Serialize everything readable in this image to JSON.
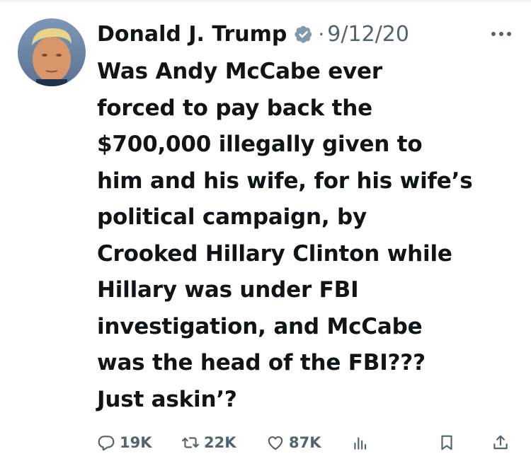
{
  "tweet": {
    "author_name": "Donald J. Trump",
    "separator": "·",
    "date": "9/12/20",
    "text_lines": [
      "Was Andy McCabe ever",
      "forced to pay back the",
      "$700,000 illegally given to",
      "him and his wife, for his wife’s",
      "political campaign, by",
      "Crooked Hillary Clinton while",
      "Hillary was under FBI",
      "investigation, and McCabe",
      "was the head of the FBI???",
      "Just askin’?"
    ]
  },
  "actions": {
    "replies": "19K",
    "retweets": "22K",
    "likes": "87K"
  },
  "icons": {
    "verified": "verified-badge-icon",
    "more": "more-options-icon",
    "reply": "reply-icon",
    "retweet": "retweet-icon",
    "like": "heart-icon",
    "views": "views-icon",
    "bookmark": "bookmark-icon",
    "share": "share-icon"
  },
  "colors": {
    "text": "#0f1419",
    "secondary": "#536471",
    "verified_badge": "#829aab"
  }
}
